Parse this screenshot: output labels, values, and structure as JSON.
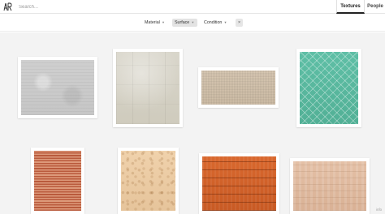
{
  "header": {
    "logo_alt": "ARQ",
    "search_placeholder": "Search...",
    "tabs": [
      {
        "label": "Textures",
        "active": true
      },
      {
        "label": "People",
        "active": false
      }
    ]
  },
  "filters": [
    {
      "label": "Material",
      "active": false
    },
    {
      "label": "Surface",
      "active": true
    },
    {
      "label": "Condition",
      "active": false
    }
  ],
  "clear_filters_icon": "close-icon",
  "gallery": {
    "items": [
      {
        "name": "concrete-texture",
        "color": "#cccccc"
      },
      {
        "name": "stone-tile-texture",
        "color": "#d6d2c6"
      },
      {
        "name": "linen-fabric-texture",
        "color": "#d5c5b0"
      },
      {
        "name": "green-tile-texture",
        "color": "#58b89e"
      },
      {
        "name": "red-stripe-texture",
        "color": "#c46a4a"
      },
      {
        "name": "sandstone-texture",
        "color": "#ebcba2"
      },
      {
        "name": "orange-wood-plank-texture",
        "color": "#d2622a"
      },
      {
        "name": "light-wood-texture",
        "color": "#dfb89e"
      }
    ],
    "scroll_hint": "info"
  },
  "colors": {
    "background": "#f3f3f3",
    "active_tab_underline": "#222222",
    "active_filter_bg": "#e3e3e3"
  }
}
